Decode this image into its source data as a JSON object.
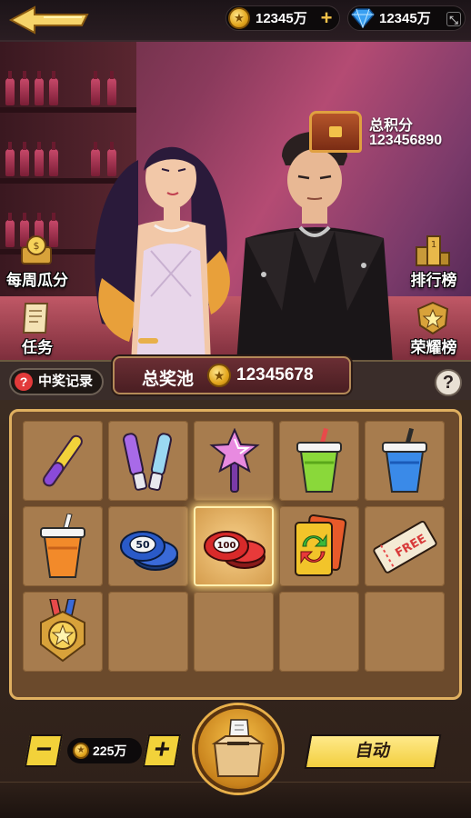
{
  "header": {
    "gold_amount": "12345万",
    "gem_amount": "12345万"
  },
  "hero": {
    "total_score_label": "总积分",
    "total_score_value": "123456890",
    "left_buttons": [
      {
        "label": "每周瓜分"
      },
      {
        "label": "任务"
      }
    ],
    "right_buttons": [
      {
        "label": "排行榜"
      },
      {
        "label": "荣耀榜"
      }
    ]
  },
  "pool": {
    "win_record_label": "中奖记录",
    "label": "总奖池",
    "value": "12345678",
    "help_glyph": "?"
  },
  "board": {
    "items": [
      {
        "icon": "yellow-purple-glowstick-icon"
      },
      {
        "icon": "light-sticks-icon"
      },
      {
        "icon": "star-wand-icon"
      },
      {
        "icon": "green-drink-cup-icon"
      },
      {
        "icon": "blue-drink-cup-icon"
      },
      {
        "icon": "orange-drink-cup-icon"
      },
      {
        "icon": "blue-50-chips-icon",
        "text": "50"
      },
      {
        "icon": "red-100-chips-icon",
        "text": "100",
        "active": true
      },
      {
        "icon": "swap-card-icon"
      },
      {
        "icon": "free-ticket-icon",
        "text": "FREE"
      },
      {
        "icon": "star-medal-icon"
      },
      {
        "icon": ""
      },
      {
        "icon": ""
      },
      {
        "icon": ""
      },
      {
        "icon": ""
      }
    ]
  },
  "controls": {
    "minus_glyph": "−",
    "plus_glyph": "+",
    "bet_amount": "225万",
    "auto_label": "自动"
  },
  "colors": {
    "accent_yellow": "#f2d23a",
    "board_frame": "#e0b060",
    "cell": "#a77c4e"
  }
}
